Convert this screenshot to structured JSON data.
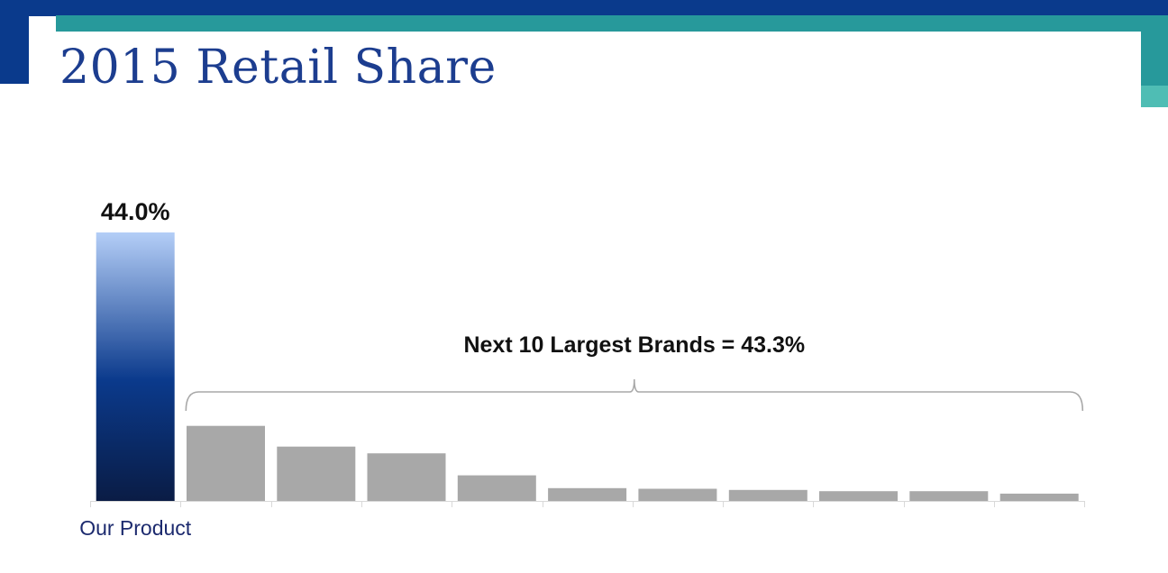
{
  "slide": {
    "title": "2015 Retail Share"
  },
  "colors": {
    "header_navy": "#0a3a8c",
    "header_teal": "#27999b",
    "header_aqua": "#4fbdb4",
    "title": "#1c3d8f",
    "highlight_bar_top": "#b4cef7",
    "highlight_bar_mid": "#0b3a8c",
    "highlight_bar_bottom": "#0a1c45",
    "other_bars": "#a8a8a8",
    "category_label": "#1c2a6e",
    "bracket": "#a8a8a8"
  },
  "chart_data": {
    "type": "bar",
    "categories": [
      "Our Product",
      "",
      "",
      "",
      "",
      "",
      "",
      "",
      "",
      "",
      ""
    ],
    "values": [
      44.0,
      12.3,
      8.9,
      7.8,
      4.2,
      2.1,
      2.0,
      1.8,
      1.6,
      1.6,
      1.2
    ],
    "ylim": [
      0,
      44.0
    ],
    "grid": false,
    "highlight_index": 0,
    "data_labels": [
      {
        "index": 0,
        "text": "44.0%"
      }
    ],
    "annotations": [
      {
        "text": "Next 10 Largest Brands = 43.3%",
        "spans": [
          1,
          10
        ]
      }
    ]
  }
}
